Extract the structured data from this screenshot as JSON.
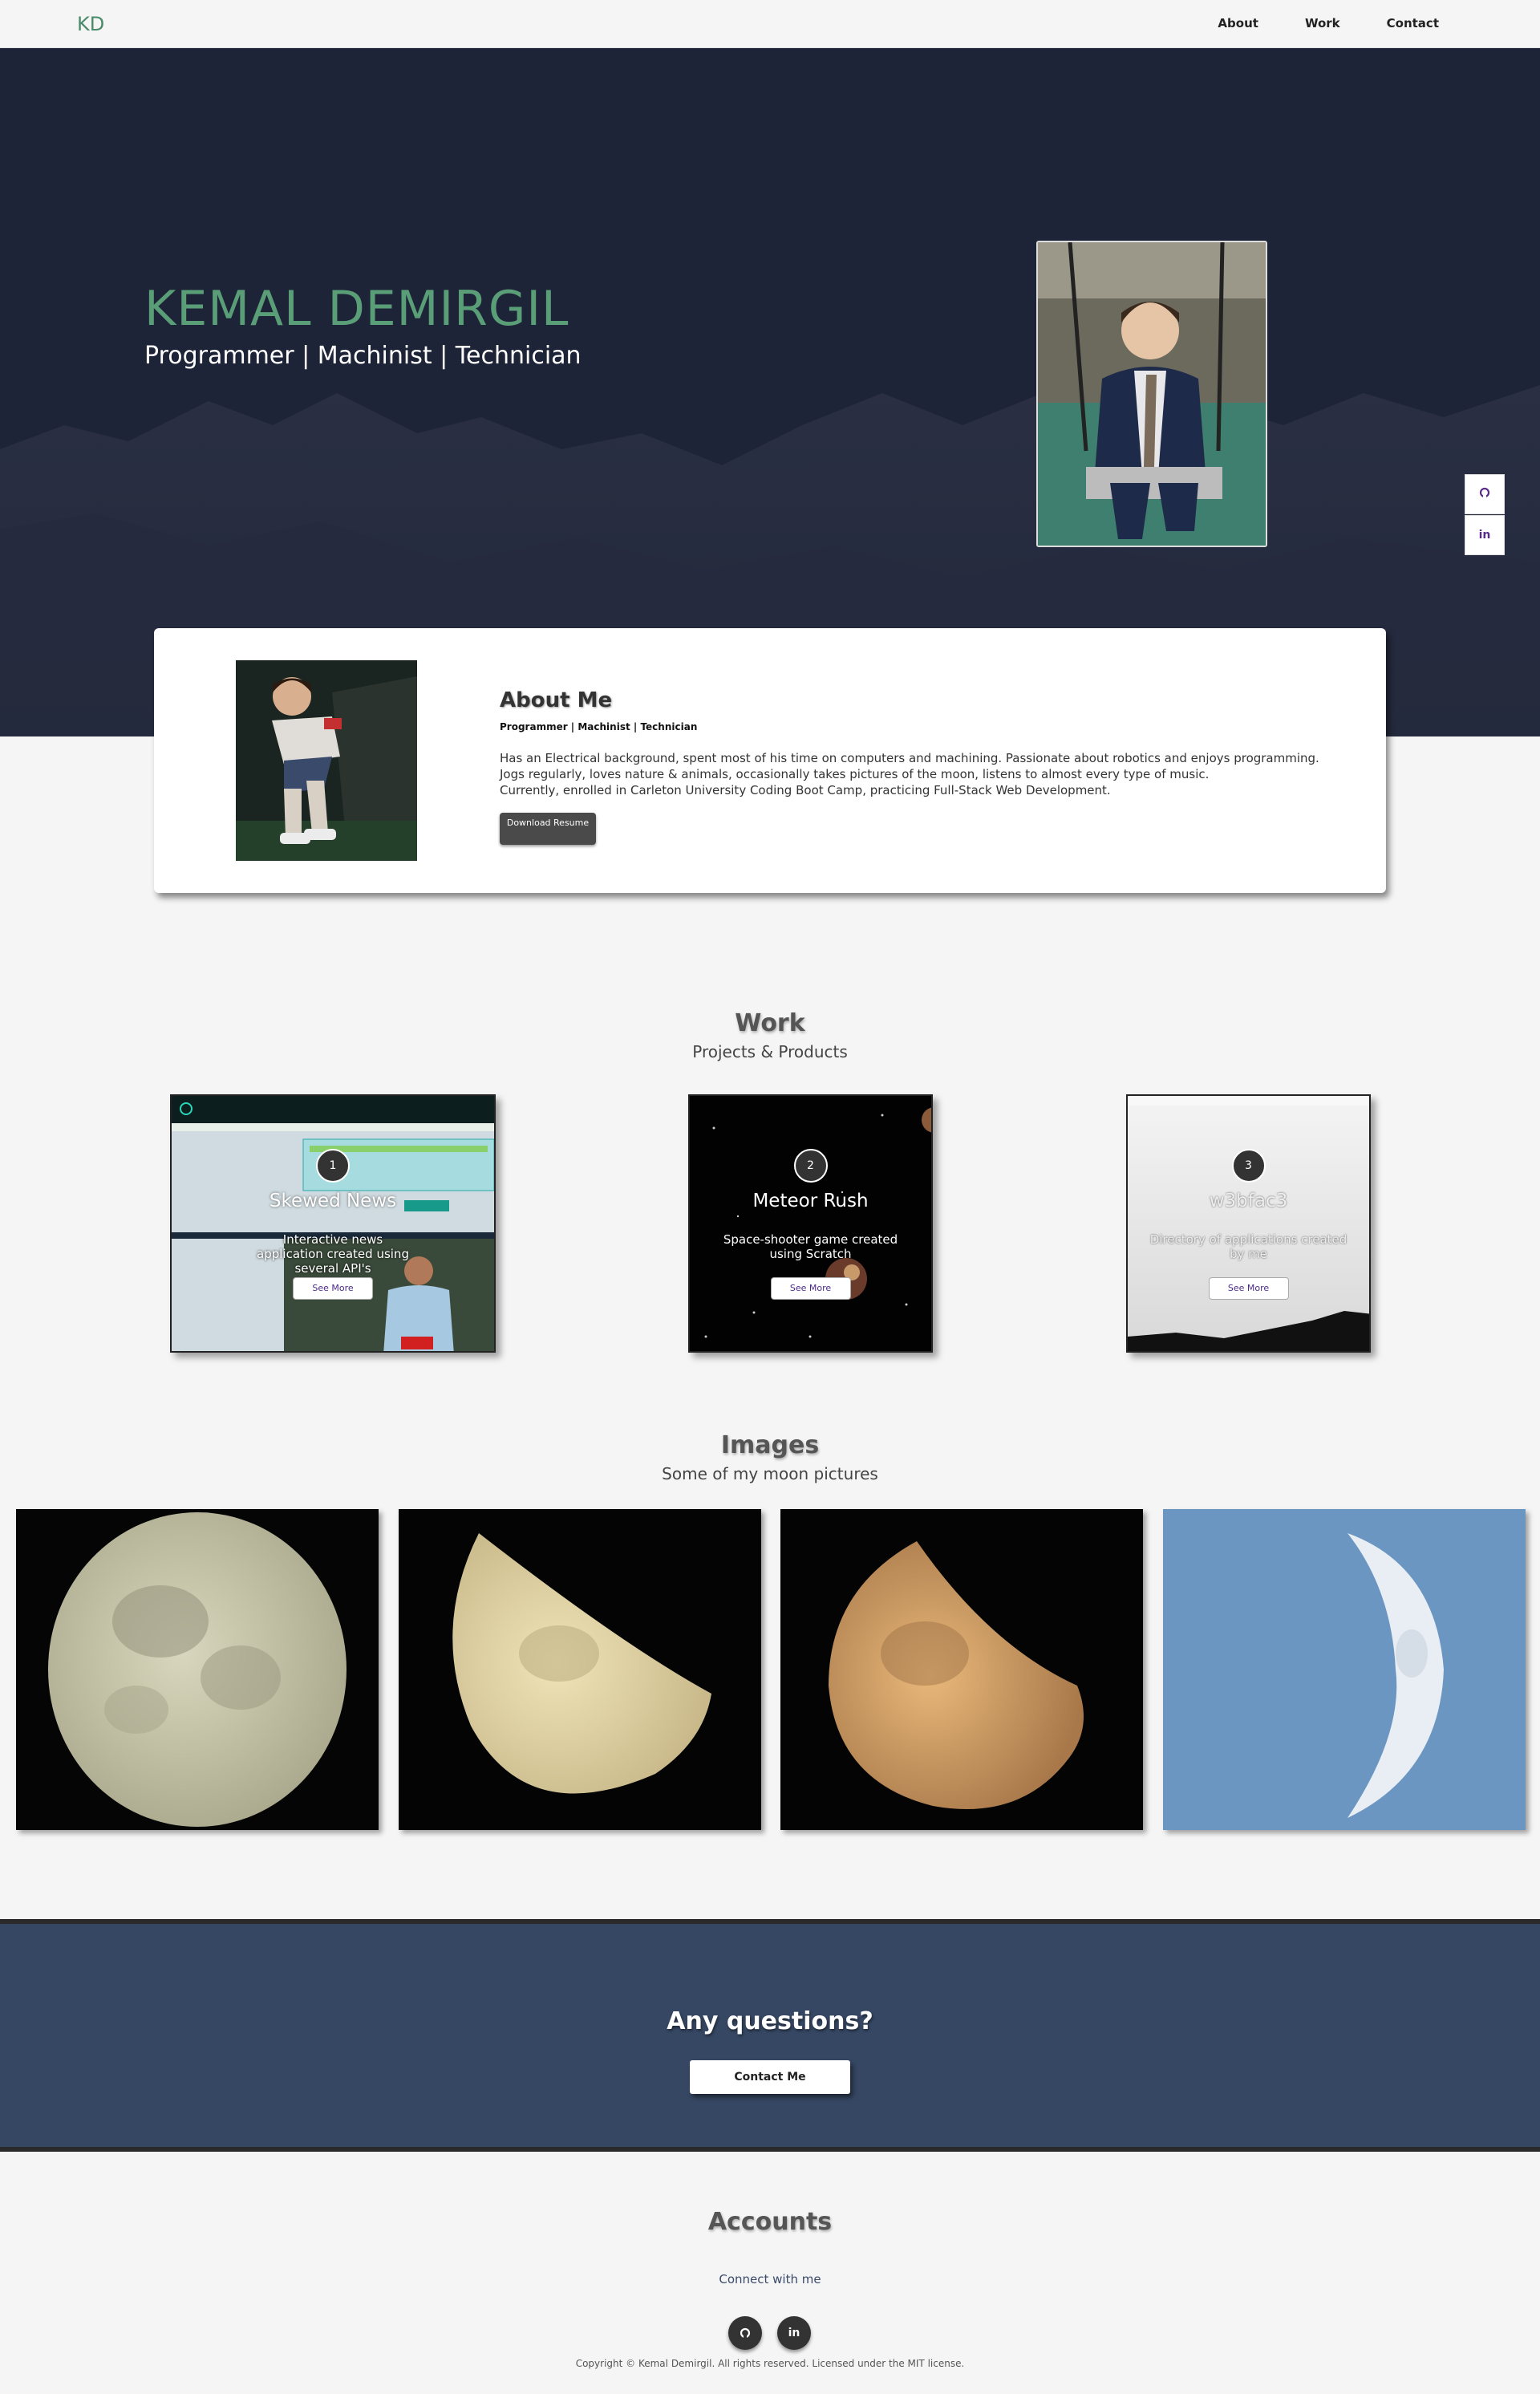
{
  "nav": {
    "logo": "KD",
    "links": [
      "About",
      "Work",
      "Contact"
    ]
  },
  "hero": {
    "name": "KEMAL DEMIRGIL",
    "tagline": "Programmer | Machinist | Technician"
  },
  "social_side": {
    "github_icon": "github-icon",
    "linkedin_label": "in"
  },
  "about": {
    "title": "About Me",
    "subtitle": "Programmer | Machinist | Technician",
    "desc_lines": [
      "Has an Electrical background, spent most of his time on computers and machining. Passionate about robotics and enjoys programming.",
      "Jogs regularly, loves nature & animals, occasionally takes pictures of the moon, listens to almost every type of music.",
      "Currently, enrolled in Carleton University Coding Boot Camp, practicing Full-Stack Web Development."
    ],
    "button": "Download Resume"
  },
  "work": {
    "title": "Work",
    "subtitle": "Projects & Products",
    "projects": [
      {
        "num": "1",
        "name": "Skewed News",
        "desc": "Interactive news application created using several API's",
        "button": "See More"
      },
      {
        "num": "2",
        "name": "Meteor Rush",
        "desc": "Space-shooter game created using Scratch",
        "button": "See More"
      },
      {
        "num": "3",
        "name": "w3bfac3",
        "desc": "Directory of applications created by me",
        "button": "See More"
      }
    ]
  },
  "images": {
    "title": "Images",
    "subtitle": "Some of my moon pictures"
  },
  "questions": {
    "title": "Any questions?",
    "button": "Contact Me"
  },
  "accounts": {
    "title": "Accounts",
    "subtitle": "Connect with me",
    "linkedin_label": "in",
    "copyright": "Copyright © Kemal Demirgil. All rights reserved. Licensed under the MIT license."
  }
}
